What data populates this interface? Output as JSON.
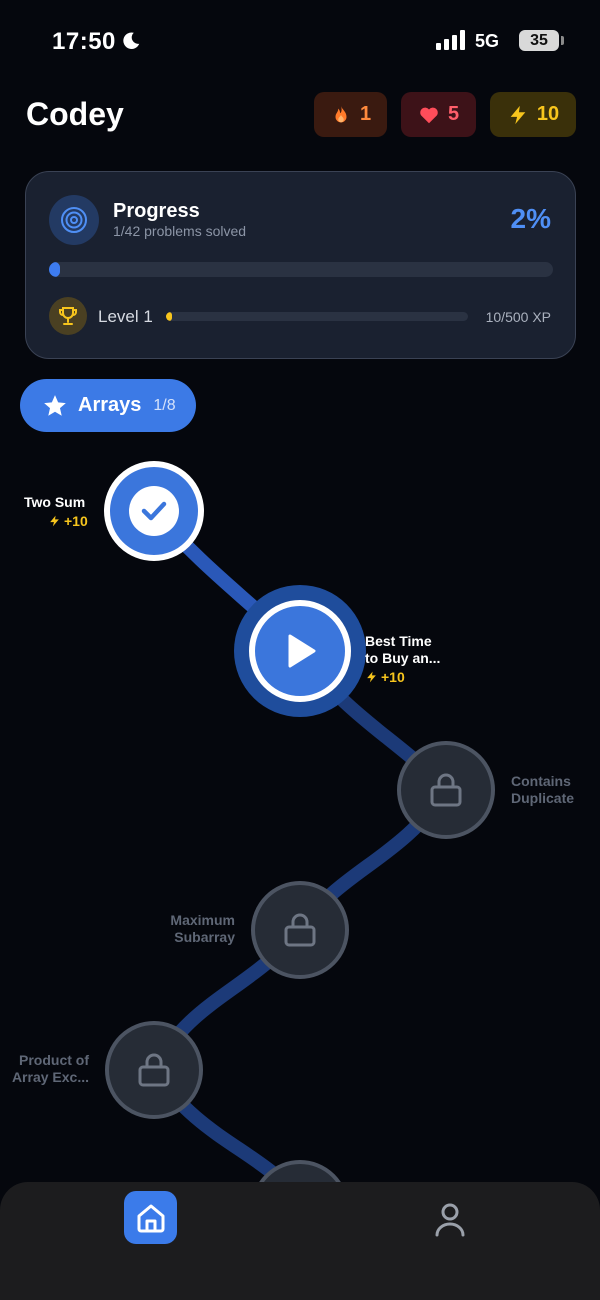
{
  "status_bar": {
    "time": "17:50",
    "network": "5G",
    "battery": "35"
  },
  "header": {
    "title": "Codey",
    "streak": "1",
    "lives": "5",
    "xp": "10"
  },
  "progress_card": {
    "title": "Progress",
    "subtitle": "1/42 problems solved",
    "percent_label": "2%",
    "percent": 2,
    "level_label": "Level 1",
    "xp_label": "10/500 XP",
    "xp_fraction": 0.02
  },
  "unit": {
    "name": "Arrays",
    "count": "1/8"
  },
  "lessons": [
    {
      "title_line1": "Two Sum",
      "title_line2": "",
      "xp": "+10",
      "state": "completed"
    },
    {
      "title_line1": "Best Time",
      "title_line2": "to Buy an...",
      "xp": "+10",
      "state": "current"
    },
    {
      "title_line1": "Contains",
      "title_line2": "Duplicate",
      "state": "locked"
    },
    {
      "title_line1": "Maximum",
      "title_line2": "Subarray",
      "state": "locked"
    },
    {
      "title_line1": "Product of",
      "title_line2": "Array Exc...",
      "state": "locked"
    }
  ],
  "colors": {
    "accent": "#3b76dc",
    "xp": "#f7c51d",
    "streak": "#ff8a3d",
    "lives": "#ff5f6b",
    "background": "#05070d"
  },
  "icons": {
    "streak": "flame-icon",
    "lives": "heart-icon",
    "xp": "lightning-icon",
    "progress": "target-icon",
    "level": "trophy-icon",
    "unit": "star-icon",
    "completed": "check-icon",
    "current": "play-icon",
    "locked": "lock-icon",
    "nav_home": "home-icon",
    "nav_profile": "profile-icon"
  }
}
